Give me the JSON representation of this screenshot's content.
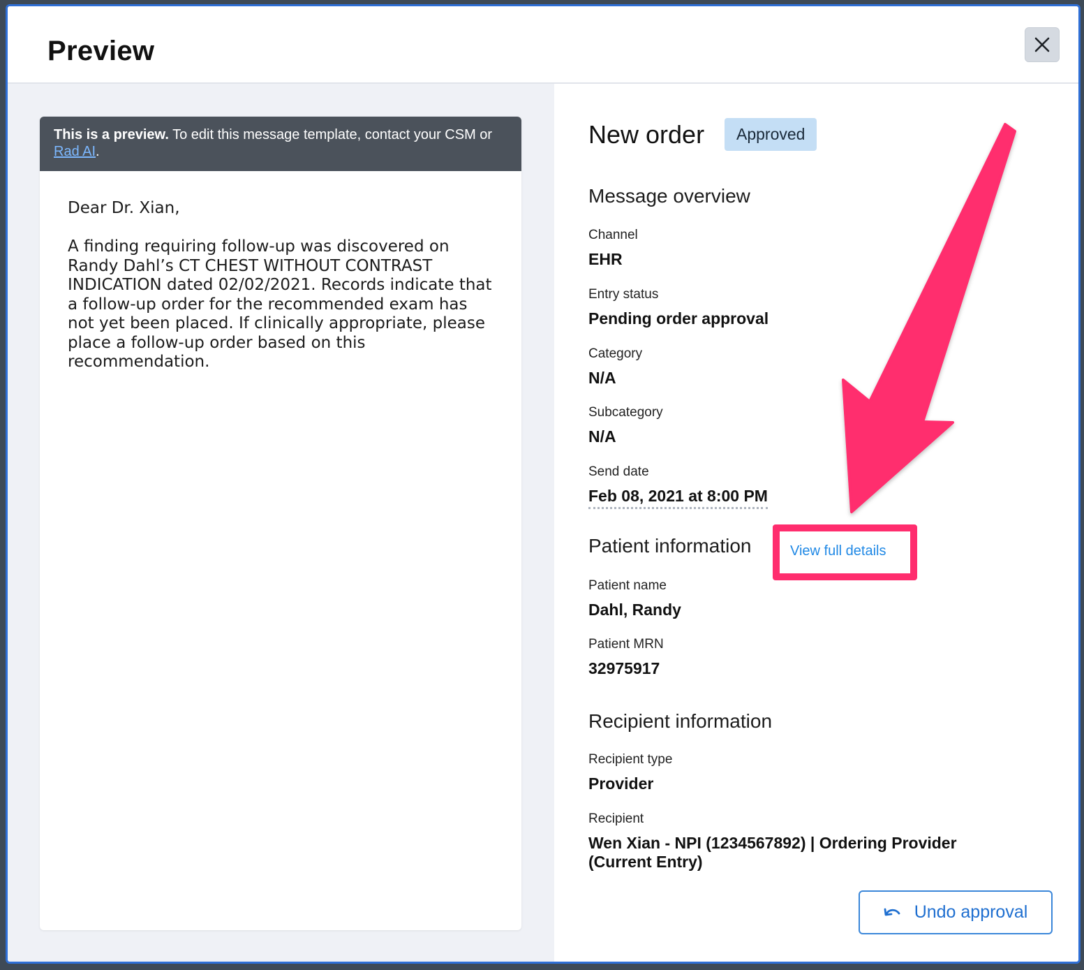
{
  "modal": {
    "title": "Preview",
    "close_icon": "close-icon"
  },
  "preview": {
    "banner_bold": "This is a preview.",
    "banner_text": " To edit this message template, contact your CSM or ",
    "banner_link": "Rad AI",
    "banner_end": ".",
    "greeting": "Dear Dr. Xian,",
    "body": "A finding requiring follow-up was discovered on Randy Dahl’s CT CHEST WITHOUT CONTRAST INDICATION dated 02/02/2021.  Records indicate that a follow-up order for the recommended exam has not yet been placed.  If clinically appropriate, please place a follow-up order based on this recommendation."
  },
  "details": {
    "title": "New order",
    "status_badge": "Approved",
    "status_color": "#c4def5",
    "message_overview": {
      "heading": "Message overview",
      "channel_label": "Channel",
      "channel_value": "EHR",
      "entry_status_label": "Entry status",
      "entry_status_value": "Pending order approval",
      "category_label": "Category",
      "category_value": "N/A",
      "subcategory_label": "Subcategory",
      "subcategory_value": "N/A",
      "send_date_label": "Send date",
      "send_date_value": "Feb 08, 2021 at 8:00 PM"
    },
    "patient": {
      "heading": "Patient information",
      "view_full_details": "View full details",
      "name_label": "Patient name",
      "name_value": "Dahl, Randy",
      "mrn_label": "Patient MRN",
      "mrn_value": "32975917"
    },
    "recipient": {
      "heading": "Recipient information",
      "type_label": "Recipient type",
      "type_value": "Provider",
      "recipient_label": "Recipient",
      "recipient_value": "Wen Xian - NPI (1234567892) | Ordering Provider (Current Entry)"
    },
    "undo_button": "Undo approval",
    "undo_icon": "undo-icon"
  },
  "annotation": {
    "highlight_color": "#ff2d6e",
    "arrow_icon": "arrow-annotation"
  }
}
